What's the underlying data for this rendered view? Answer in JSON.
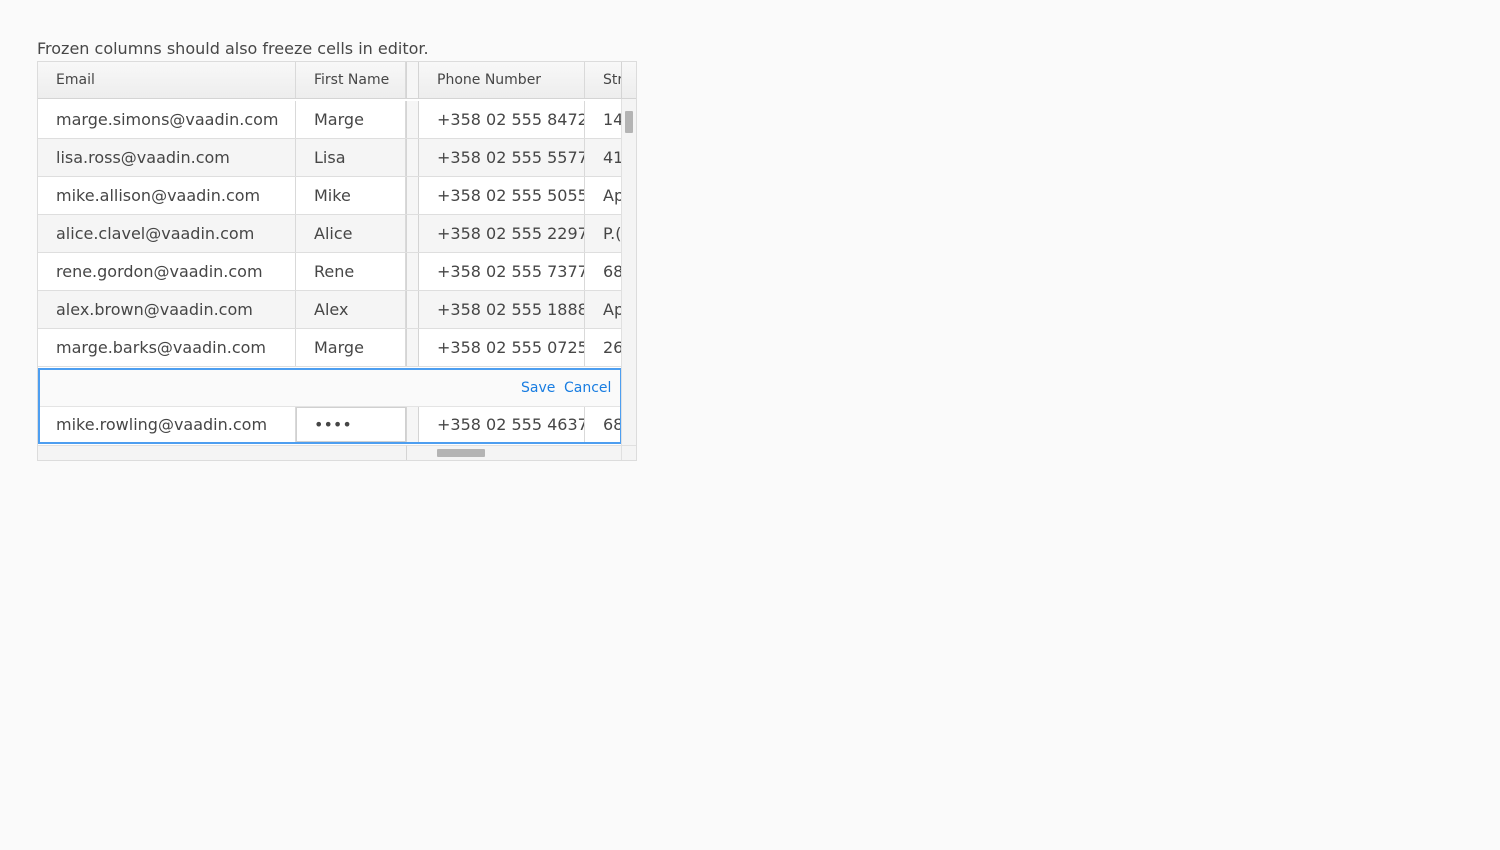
{
  "caption": "Frozen columns should also freeze cells in editor.",
  "grid": {
    "columns": {
      "email": "Email",
      "first_name": "First Name",
      "phone": "Phone Number",
      "street": "Str"
    },
    "rows": [
      {
        "email": "marge.simons@vaadin.com",
        "first_name": "Marge",
        "phone": "+358 02 555 8472",
        "street": "14"
      },
      {
        "email": "lisa.ross@vaadin.com",
        "first_name": "Lisa",
        "phone": "+358 02 555 5577",
        "street": "41"
      },
      {
        "email": "mike.allison@vaadin.com",
        "first_name": "Mike",
        "phone": "+358 02 555 5055",
        "street": "Ap"
      },
      {
        "email": "alice.clavel@vaadin.com",
        "first_name": "Alice",
        "phone": "+358 02 555 2297",
        "street": "P.("
      },
      {
        "email": "rene.gordon@vaadin.com",
        "first_name": "Rene",
        "phone": "+358 02 555 7377",
        "street": "68"
      },
      {
        "email": "alex.brown@vaadin.com",
        "first_name": "Alex",
        "phone": "+358 02 555 1888",
        "street": "Ap"
      },
      {
        "email": "marge.barks@vaadin.com",
        "first_name": "Marge",
        "phone": "+358 02 555 0725",
        "street": "26"
      }
    ],
    "editor": {
      "save_label": "Save",
      "cancel_label": "Cancel",
      "email": "mike.rowling@vaadin.com",
      "first_name_masked": "••••",
      "phone": "+358 02 555 4637",
      "street": "68"
    }
  }
}
